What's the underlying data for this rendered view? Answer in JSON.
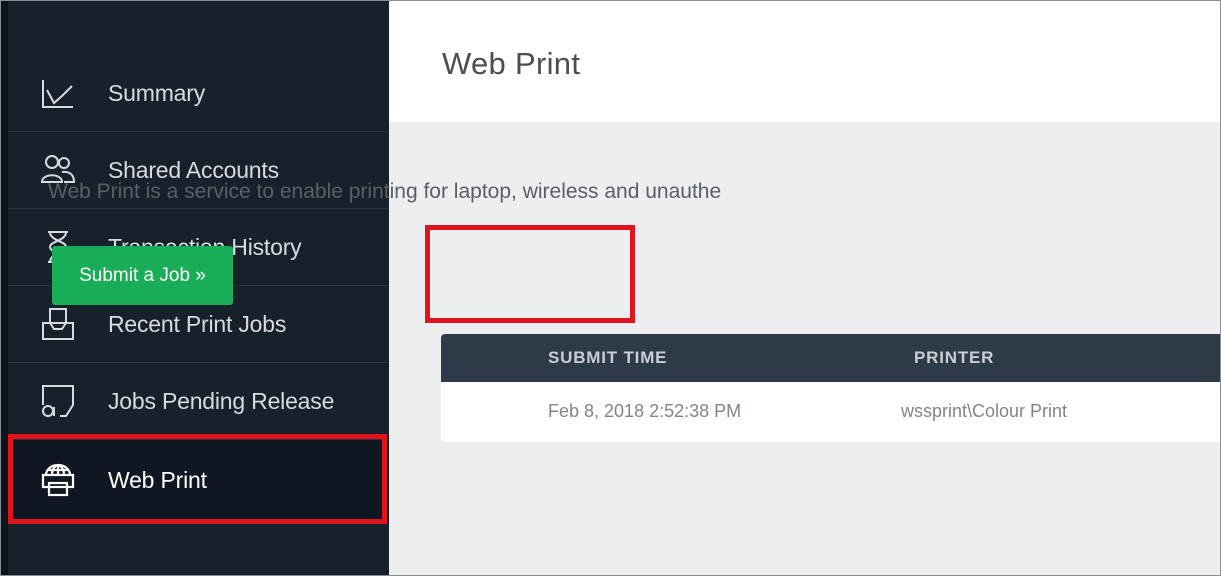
{
  "sidebar": {
    "items": [
      {
        "label": "Summary",
        "icon": "chart-line-icon"
      },
      {
        "label": "Shared Accounts",
        "icon": "shared-accounts-icon"
      },
      {
        "label": "Transaction History",
        "icon": "hourglass-icon"
      },
      {
        "label": "Recent Print Jobs",
        "icon": "print-tray-icon"
      },
      {
        "label": "Jobs Pending Release",
        "icon": "pending-release-icon"
      },
      {
        "label": "Web Print",
        "icon": "web-print-icon",
        "active": true
      }
    ]
  },
  "main": {
    "title": "Web Print",
    "description": "Web Print is a service to enable printing for laptop, wireless and unauthe",
    "submit_button": "Submit a Job »",
    "table": {
      "columns": [
        "SUBMIT TIME",
        "PRINTER"
      ],
      "rows": [
        [
          "Feb 8, 2018 2:52:38 PM",
          "wssprint\\Colour Print"
        ]
      ]
    }
  },
  "colors": {
    "sidebar_bg": "#17212c",
    "accent_green": "#1aad57",
    "highlight_red": "#e0141c",
    "table_header_bg": "#2e3a47"
  }
}
